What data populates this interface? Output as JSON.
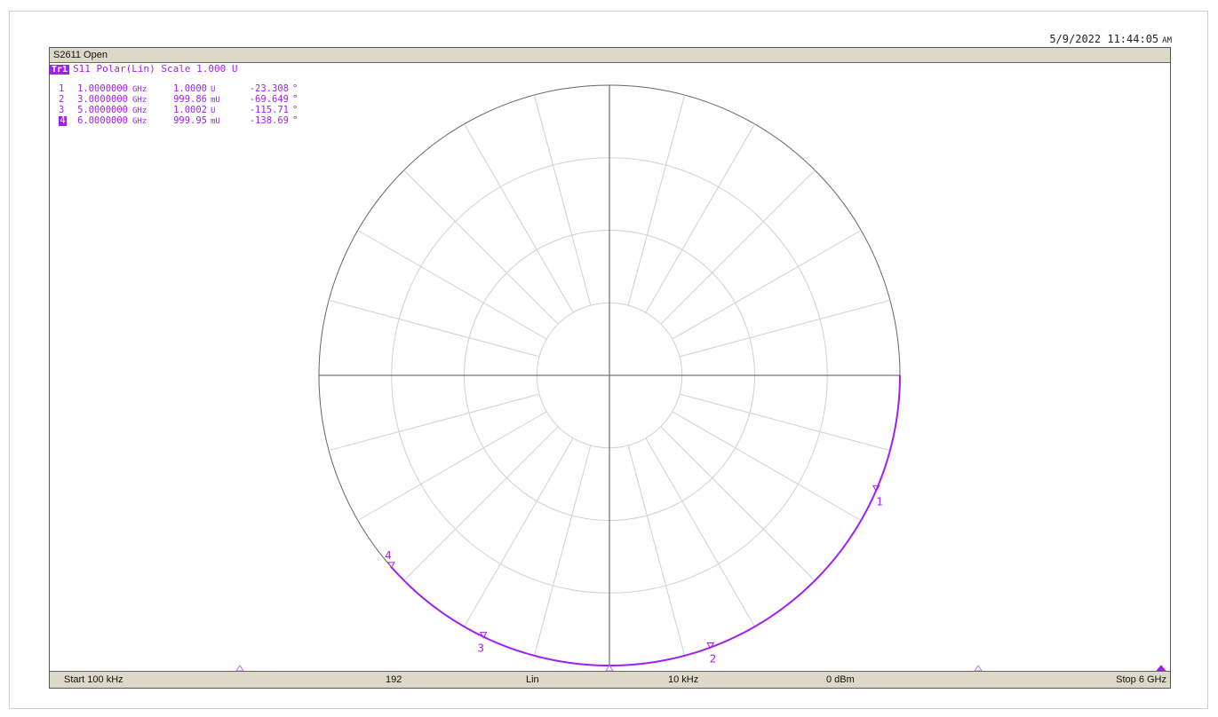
{
  "timestamp": {
    "date_time": "5/9/2022 11:44:05",
    "ampm": "AM"
  },
  "window": {
    "title": "S2611 Open"
  },
  "trace": {
    "badge": "Tr1",
    "label": "S11 Polar(Lin) Scale 1.000 U",
    "color": "#a020f0"
  },
  "markers": [
    {
      "num": "1",
      "freq": "1.0000000",
      "freq_unit": "GHz",
      "mag": "1.0000",
      "mag_unit": "U",
      "angle": "-23.308",
      "deg": "°",
      "active": false
    },
    {
      "num": "2",
      "freq": "3.0000000",
      "freq_unit": "GHz",
      "mag": "999.86",
      "mag_unit": "mU",
      "angle": "-69.649",
      "deg": "°",
      "active": false
    },
    {
      "num": "3",
      "freq": "5.0000000",
      "freq_unit": "GHz",
      "mag": "1.0002",
      "mag_unit": "U",
      "angle": "-115.71",
      "deg": "°",
      "active": false
    },
    {
      "num": "4",
      "freq": "6.0000000",
      "freq_unit": "GHz",
      "mag": "999.95",
      "mag_unit": "mU",
      "angle": "-138.69",
      "deg": "°",
      "active": true
    }
  ],
  "status_bar": {
    "start": "Start 100 kHz",
    "points": "192",
    "sweep_type": "Lin",
    "ifbw": "10 kHz",
    "power": "0 dBm",
    "stop": "Stop 6 GHz"
  },
  "chart_data": {
    "type": "polar",
    "scale": 1.0,
    "grid": {
      "rings": [
        0.25,
        0.5,
        0.75,
        1.0
      ],
      "spoke_step_deg": 15
    },
    "trace": {
      "start_angle_deg": 0,
      "end_angle_deg": -138.69,
      "magnitude": 1.0
    },
    "markers": [
      {
        "label": "1",
        "angle_deg": -23.308,
        "magnitude": 1.0
      },
      {
        "label": "2",
        "angle_deg": -69.649,
        "magnitude": 0.99986
      },
      {
        "label": "3",
        "angle_deg": -115.71,
        "magnitude": 1.0002
      },
      {
        "label": "4",
        "angle_deg": -138.69,
        "magnitude": 0.99995
      }
    ]
  }
}
